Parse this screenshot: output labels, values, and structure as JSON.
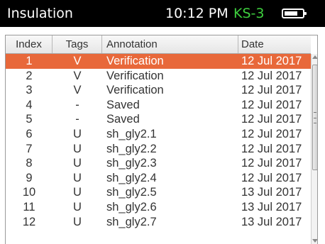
{
  "statusbar": {
    "title": "Insulation",
    "time": "10:12 PM",
    "device_id": "KS-3",
    "device_id_color": "#3ecf3e",
    "battery_icon": "battery-icon",
    "battery_level": 0.8
  },
  "table": {
    "columns": [
      "Index",
      "Tags",
      "Annotation",
      "Date"
    ],
    "selected_row_color": "#e8683a",
    "rows": [
      {
        "index": "1",
        "tag": "V",
        "annotation": "Verification",
        "date": "12 Jul 2017",
        "selected": true
      },
      {
        "index": "2",
        "tag": "V",
        "annotation": "Verification",
        "date": "12 Jul 2017"
      },
      {
        "index": "3",
        "tag": "V",
        "annotation": "Verification",
        "date": "12 Jul 2017"
      },
      {
        "index": "4",
        "tag": "-",
        "annotation": "Saved",
        "date": "12 Jul 2017"
      },
      {
        "index": "5",
        "tag": "-",
        "annotation": "Saved",
        "date": "12 Jul 2017"
      },
      {
        "index": "6",
        "tag": "U",
        "annotation": "sh_gly2.1",
        "date": "12 Jul 2017"
      },
      {
        "index": "7",
        "tag": "U",
        "annotation": "sh_gly2.2",
        "date": "12 Jul 2017"
      },
      {
        "index": "8",
        "tag": "U",
        "annotation": "sh_gly2.3",
        "date": "12 Jul 2017"
      },
      {
        "index": "9",
        "tag": "U",
        "annotation": "sh_gly2.4",
        "date": "12 Jul 2017"
      },
      {
        "index": "10",
        "tag": "U",
        "annotation": "sh_gly2.5",
        "date": "13 Jul 2017"
      },
      {
        "index": "11",
        "tag": "U",
        "annotation": "sh_gly2.6",
        "date": "13 Jul 2017"
      },
      {
        "index": "12",
        "tag": "U",
        "annotation": "sh_gly2.7",
        "date": "13 Jul 2017"
      }
    ]
  },
  "scrollbar": {
    "position": 0.05,
    "visible_fraction": 0.6
  }
}
